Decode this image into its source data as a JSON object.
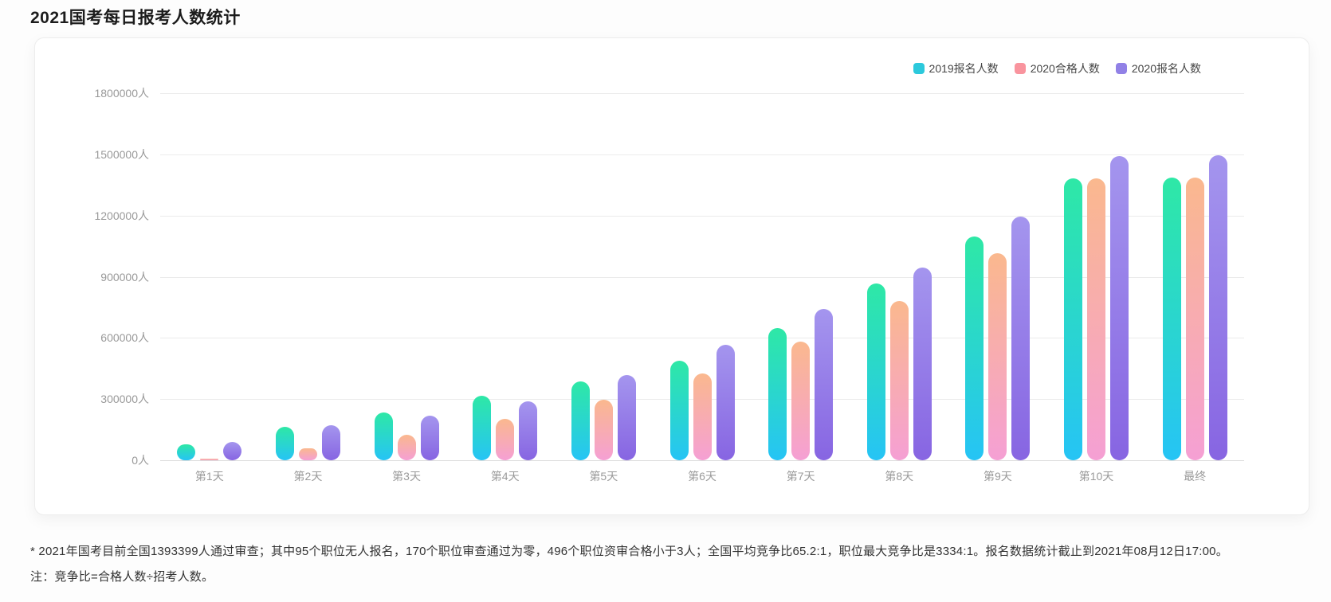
{
  "page": {
    "title": "2021国考每日报考人数统计",
    "footnotes": {
      "line1": "* 2021年国考目前全国1393399人通过审查；其中95个职位无人报名，170个职位审查通过为零，496个职位资审合格小于3人；全国平均竞争比65.2:1，职位最大竞争比是3334:1。报名数据统计截止到2021年08月12日17:00。",
      "line2": "注：竞争比=合格人数÷招考人数。"
    }
  },
  "chart_data": {
    "type": "bar",
    "title": "2021国考每日报考人数统计",
    "categories": [
      "第1天",
      "第2天",
      "第3天",
      "第4天",
      "第5天",
      "第6天",
      "第7天",
      "第8天",
      "第9天",
      "第10天",
      "最终"
    ],
    "series": [
      {
        "name": "2019报名人数",
        "legend_color": "#2cc9dc",
        "gradient_top": "#2ee8a6",
        "gradient_bottom": "#26c4f5",
        "values": [
          78000,
          163000,
          235000,
          315000,
          385000,
          488000,
          650000,
          865000,
          1098000,
          1382000,
          1388000
        ]
      },
      {
        "name": "2020合格人数",
        "legend_color": "#f9949e",
        "gradient_top": "#fab88e",
        "gradient_bottom": "#f5a0d4",
        "values": [
          8000,
          60000,
          125000,
          203000,
          297000,
          426000,
          582000,
          780000,
          1016000,
          1383000,
          1385000
        ]
      },
      {
        "name": "2020报名人数",
        "legend_color": "#9181e6",
        "gradient_top": "#a495ee",
        "gradient_bottom": "#8765e2",
        "values": [
          88000,
          173000,
          220000,
          287000,
          418000,
          566000,
          740000,
          944000,
          1194000,
          1490000,
          1494000
        ]
      }
    ],
    "y_tick_labels": [
      "0人",
      "300000人",
      "600000人",
      "900000人",
      "1200000人",
      "1500000人",
      "1800000人"
    ],
    "ylim": [
      0,
      1800000
    ],
    "ytick_interval": 300000,
    "unit": "人",
    "xlabel": "",
    "ylabel": "",
    "grid": true,
    "legend_position": "top-right"
  }
}
